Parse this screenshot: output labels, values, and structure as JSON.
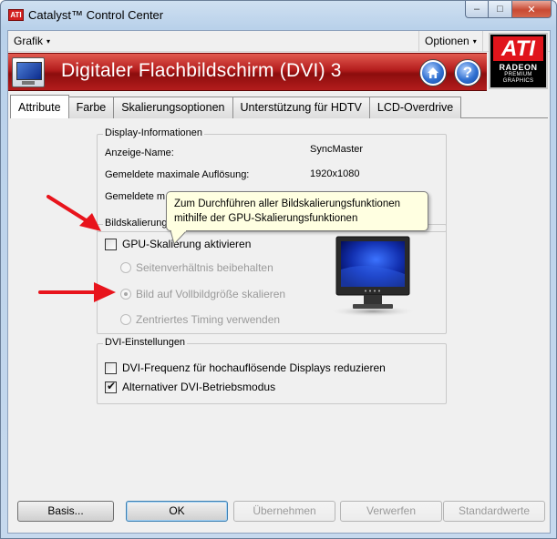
{
  "window": {
    "title": "Catalyst™ Control Center",
    "logo_text": "ATI"
  },
  "window_controls": {
    "minimize": "–",
    "maximize": "□",
    "close": "✕"
  },
  "menu": {
    "grafik": "Grafik",
    "optionen": "Optionen",
    "caret": "▾"
  },
  "banner": {
    "title": "Digitaler Flachbildschirm (DVI) 3",
    "help": "?"
  },
  "ati_logo": {
    "brand": "ATI",
    "line1": "RADEON",
    "line2": "PREMIUM",
    "line3": "GRAPHICS"
  },
  "tabs": [
    {
      "label": "Attribute",
      "active": true
    },
    {
      "label": "Farbe",
      "active": false
    },
    {
      "label": "Skalierungsoptionen",
      "active": false
    },
    {
      "label": "Unterstützung für HDTV",
      "active": false
    },
    {
      "label": "LCD-Overdrive",
      "active": false
    }
  ],
  "display_info": {
    "legend": "Display-Informationen",
    "rows": [
      {
        "label": "Anzeige-Name:",
        "value": "SyncMaster"
      },
      {
        "label": "Gemeldete maximale Auflösung:",
        "value": "1920x1080"
      },
      {
        "label": "Gemeldete m",
        "value": ""
      }
    ]
  },
  "scaling": {
    "legend": "Bildskalierung",
    "enable_gpu_label": "GPU-Skalierung aktivieren",
    "enable_gpu_checked": false,
    "options": [
      {
        "label": "Seitenverhältnis beibehalten",
        "selected": false
      },
      {
        "label": "Bild auf Vollbildgröße skalieren",
        "selected": true
      },
      {
        "label": "Zentriertes Timing verwenden",
        "selected": false
      }
    ]
  },
  "tooltip": {
    "text": "Zum Durchführen aller Bildskalierungsfunktionen mithilfe der GPU-Skalierungsfunktionen"
  },
  "dvi": {
    "legend": "DVI-Einstellungen",
    "options": [
      {
        "label": "DVI-Frequenz für hochauflösende Displays reduzieren",
        "checked": false
      },
      {
        "label": "Alternativer DVI-Betriebsmodus",
        "checked": true
      }
    ]
  },
  "buttons": {
    "basis": "Basis...",
    "ok": "OK",
    "apply": "Übernehmen",
    "discard": "Verwerfen",
    "defaults": "Standardwerte"
  },
  "colors": {
    "banner_red": "#b41d1d",
    "ati_red": "#e0141b",
    "tooltip_bg": "#ffffe1",
    "arrow_red": "#e8141c"
  }
}
